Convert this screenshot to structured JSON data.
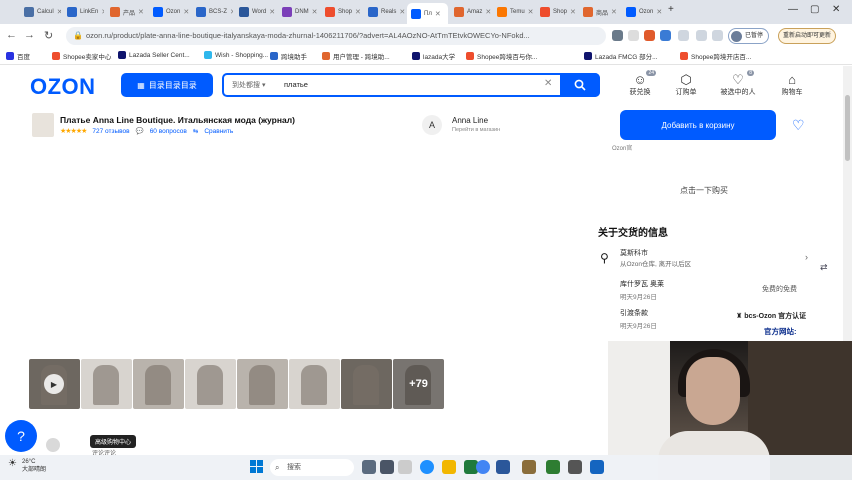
{
  "browser": {
    "tabs": [
      {
        "label": "Calcul",
        "color": "#4a6fa5"
      },
      {
        "label": "LinkEn",
        "color": "#2a66c9"
      },
      {
        "label": "产品",
        "color": "#e0662e"
      },
      {
        "label": "Ozon",
        "color": "#005bff"
      },
      {
        "label": "BCS-Z",
        "color": "#2a66c9"
      },
      {
        "label": "Word",
        "color": "#2b579a"
      },
      {
        "label": "DNM",
        "color": "#7b3fb8"
      },
      {
        "label": "Shop",
        "color": "#ee4d2d"
      },
      {
        "label": "Reals",
        "color": "#2a66c9"
      },
      {
        "label": "Пл",
        "color": "#005bff"
      },
      {
        "label": "Amaz",
        "color": "#e0662e"
      },
      {
        "label": "Temu",
        "color": "#fb7701"
      },
      {
        "label": "Shop",
        "color": "#ee4d2d"
      },
      {
        "label": "商品",
        "color": "#e0662e"
      },
      {
        "label": "Ozon",
        "color": "#005bff"
      }
    ],
    "url": "ozon.ru/product/plate-anna-line-boutique-italyanskaya-moda-zhurnal-1406211706/?advert=AL4AOzNO-AtTmTEtvkOWECYo-NFokd...",
    "paused_label": "已暂停",
    "relaunch_label": "重新启动即可更新",
    "bookmarks": [
      {
        "label": "百度",
        "color": "#2932e1"
      },
      {
        "label": "Shopee卖家中心",
        "color": "#ee4d2d"
      },
      {
        "label": "Lazada Seller Cent...",
        "color": "#0f146d"
      },
      {
        "label": "Wish - Shopping...",
        "color": "#2fb7ec"
      },
      {
        "label": "跨境助手",
        "color": "#2a66c9"
      },
      {
        "label": "用户管理 - 跨境助...",
        "color": "#e0662e"
      },
      {
        "label": "lazada大学",
        "color": "#0f146d"
      },
      {
        "label": "Shopee跨境百与你...",
        "color": "#ee4d2d"
      },
      {
        "label": "Lazada FMCG 部分...",
        "color": "#0f146d"
      },
      {
        "label": "Shopee跨境开店百...",
        "color": "#ee4d2d"
      }
    ]
  },
  "ozon": {
    "logo": "OZON",
    "catalog_label": "目录目录目录",
    "search_scope": "到处都搜",
    "search_value": "платье",
    "nav": [
      {
        "label": "获兑换",
        "icon": "face-icon",
        "badge": "24"
      },
      {
        "label": "订购单",
        "icon": "box-icon",
        "badge": ""
      },
      {
        "label": "被选中的人",
        "icon": "heart-icon",
        "badge": "8"
      },
      {
        "label": "购物车",
        "icon": "bag-icon",
        "badge": ""
      }
    ],
    "brand_color": "#005bff"
  },
  "product": {
    "title": "Платье Anna Line Boutique. Итальянская мода (журнал)",
    "rating_stars": "★★★★★",
    "reviews": "727 отзывов",
    "questions": "60 вопросов",
    "compare": "Сравнить",
    "brand_initial": "A",
    "brand_name": "Anna Line",
    "brand_link": "Перейти в магазин",
    "add_to_cart": "Добавить в корзину",
    "seller_snippet": "Ozon官",
    "buy_with": "点击一下购买",
    "gallery_more": "+79"
  },
  "delivery": {
    "heading": "关于交货的信息",
    "city": "莫斯科市",
    "city_sub": "从Ozon仓库, 离开以后区",
    "rows": [
      {
        "title": "库什罗瓦 奥莱",
        "sub": "明天9月26日"
      },
      {
        "title": "引渡条款",
        "sub": "明天9月26日"
      }
    ],
    "free_pickup": "免费的免费",
    "bcs_label": "bcs-Ozon 官方认证",
    "bcs_web": "官方网站:"
  },
  "misc": {
    "hover_badge": "高级购物中心",
    "rating_line": "评论评论",
    "weather_temp": "26°C",
    "weather_desc": "大部晴朗",
    "taskbar_search": "搜索"
  }
}
